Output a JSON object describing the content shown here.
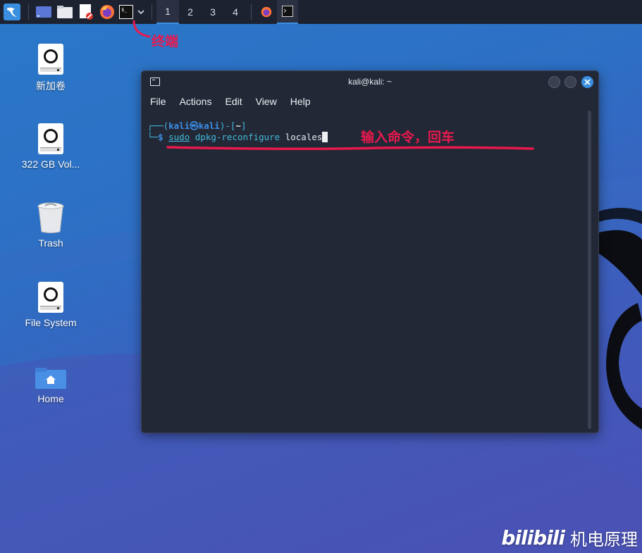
{
  "taskbar": {
    "workspaces": [
      "1",
      "2",
      "3",
      "4"
    ],
    "active_workspace": "1"
  },
  "desktop": {
    "icons": [
      {
        "label": "新加卷",
        "icon": "drive-icon"
      },
      {
        "label": "322 GB Vol...",
        "icon": "drive-icon"
      },
      {
        "label": "Trash",
        "icon": "trash-icon"
      },
      {
        "label": "File System",
        "icon": "drive-icon"
      },
      {
        "label": "Home",
        "icon": "home-folder-icon"
      }
    ]
  },
  "terminal": {
    "title": "kali@kali: ~",
    "menu": [
      "File",
      "Actions",
      "Edit",
      "View",
      "Help"
    ],
    "prompt": {
      "open": "┌──(",
      "user_host": "kali㉿kali",
      "sep": ")-[",
      "dir": "~",
      "close": "]",
      "second_prefix": "└─",
      "dollar": "$"
    },
    "command": {
      "sudo": "sudo",
      "cmd": "dpkg-reconfigure",
      "arg": "locales"
    }
  },
  "annotations": {
    "terminal_label": "终端",
    "command_note": "输入命令，回车"
  },
  "watermark": {
    "logo": "bilibili",
    "text": "机电原理"
  },
  "colors": {
    "accent": "#3b8fe0",
    "annotation": "#e8194e",
    "terminal_bg": "#232836"
  }
}
